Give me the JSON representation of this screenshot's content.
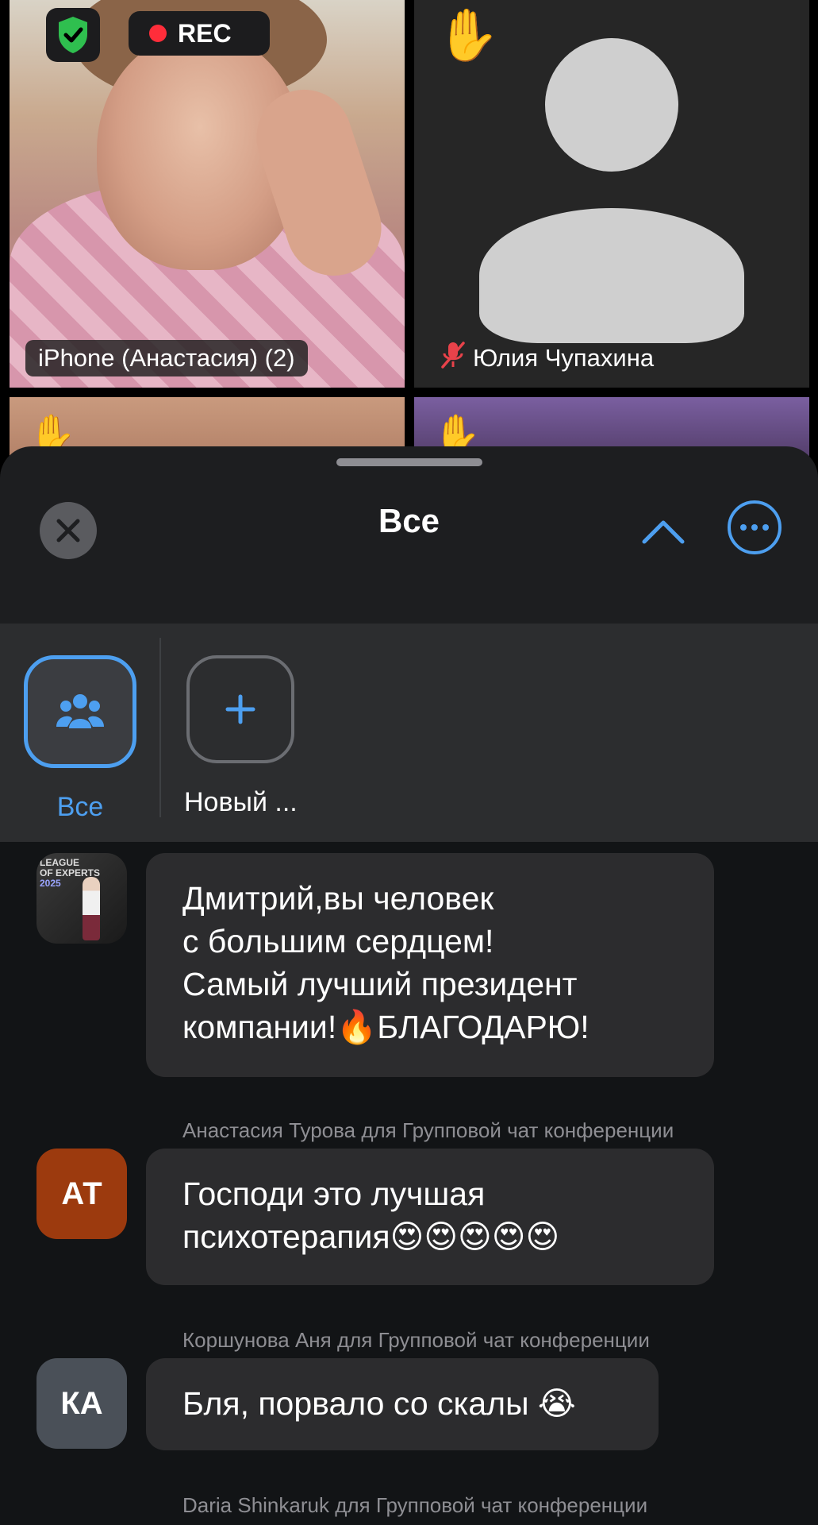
{
  "video": {
    "rec_label": "REC",
    "tiles": [
      {
        "name": "iPhone (Анастасия) (2)"
      },
      {
        "name": "Юлия Чупахина"
      }
    ]
  },
  "sheet": {
    "title": "Все",
    "channels": [
      {
        "label": "Все"
      },
      {
        "label": "Новый ..."
      }
    ]
  },
  "chat": {
    "messages": [
      {
        "sender": "",
        "text": "Дмитрий,вы человек\nс большим сердцем!\nСамый лучший президент\nкомпании!🔥БЛАГОДАРЮ!",
        "avatar_text": "LEAGUE\nOF EXPERTS\n2025"
      },
      {
        "sender": "Анастасия Турова для Групповой чат конференции",
        "text": "Господи это лучшая\nпсихотерапия😍😍😍😍😍",
        "avatar_initials": "АТ",
        "avatar_color": "#9c3a0e"
      },
      {
        "sender": "Коршунова Аня для Групповой чат конференции",
        "text": "Бля, порвало со скалы 😭",
        "avatar_initials": "КА",
        "avatar_color": "#4a5058"
      },
      {
        "sender": "Daria Shinkaruk для Групповой чат конференции"
      }
    ]
  },
  "colors": {
    "accent": "#4d9ff0",
    "rec": "#ff2d3a",
    "shield": "#2fbf4f"
  }
}
